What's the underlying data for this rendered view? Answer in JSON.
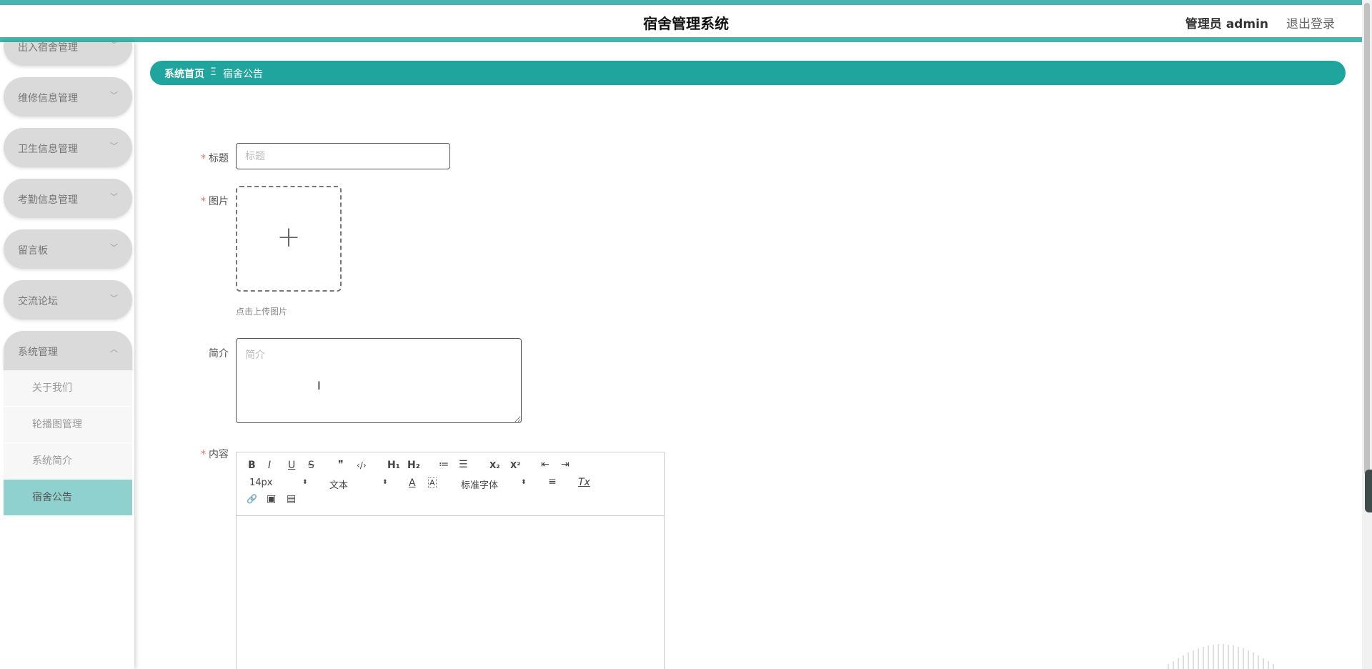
{
  "header": {
    "title": "宿舍管理系统",
    "user": "管理员 admin",
    "logout": "退出登录"
  },
  "sidebar": {
    "items": [
      {
        "label": "出入宿舍管理",
        "chevron": "﹀"
      },
      {
        "label": "维修信息管理",
        "chevron": "﹀"
      },
      {
        "label": "卫生信息管理",
        "chevron": "﹀"
      },
      {
        "label": "考勤信息管理",
        "chevron": "﹀"
      },
      {
        "label": "留言板",
        "chevron": "﹀"
      },
      {
        "label": "交流论坛",
        "chevron": "﹀"
      },
      {
        "label": "系统管理",
        "chevron": "︿"
      }
    ],
    "submenu": [
      {
        "label": "关于我们"
      },
      {
        "label": "轮播图管理"
      },
      {
        "label": "系统简介"
      },
      {
        "label": "宿舍公告"
      }
    ]
  },
  "breadcrumb": {
    "home": "系统首页",
    "separator": "Ξ",
    "current": "宿舍公告"
  },
  "form": {
    "required_mark": "*",
    "title_label": "标题",
    "title_placeholder": "标题",
    "image_label": "图片",
    "upload_plus": "+",
    "upload_hint": "点击上传图片",
    "summary_label": "简介",
    "summary_placeholder": "简介",
    "content_label": "内容"
  },
  "editor": {
    "bold": "B",
    "italic": "I",
    "underline": "U",
    "strike": "S",
    "quote": "❞",
    "code": "‹/›",
    "h1": "H₁",
    "h2": "H₂",
    "ordered_list": "≔",
    "bullet_list": "☰",
    "subscript": "X₂",
    "superscript": "X²",
    "outdent": "⇤",
    "indent": "⇥",
    "size_value": "14px",
    "header_value": "文本",
    "font_value": "标准字体",
    "font_color": "A",
    "background": "A",
    "align": "≡",
    "clean": "Tx",
    "link": "🔗",
    "image": "▣",
    "video": "▤",
    "select_arrow": "⬍"
  },
  "colors": {
    "accent": "#1fa59e",
    "stripe": "#45b5ad",
    "active_sub": "#8fd1cf",
    "required": "#f56c6c"
  }
}
